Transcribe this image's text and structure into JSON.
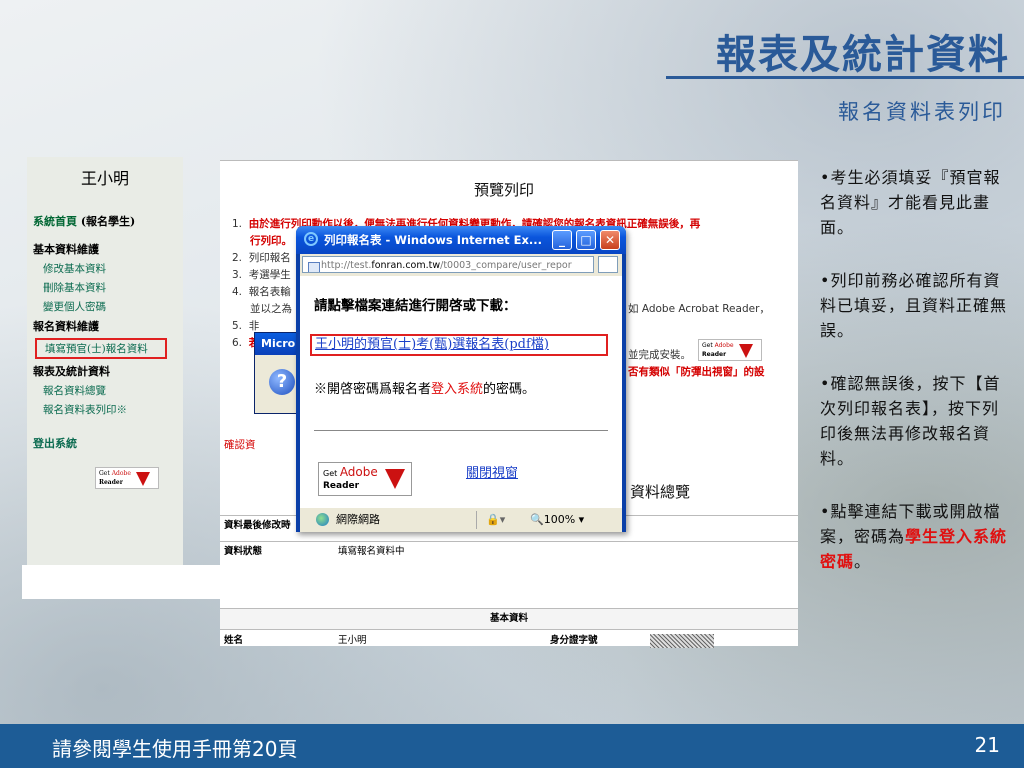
{
  "slide": {
    "title": "報表及統計資料",
    "subtitle": "報名資料表列印",
    "footer_text": "請參閱學生使用手冊第20頁",
    "page_number": "21"
  },
  "nav": {
    "user_name": "王小明",
    "home_label": "系統首頁",
    "home_role": "(報名學生)",
    "sections": [
      {
        "title": "基本資料維護",
        "items": [
          "修改基本資料",
          "刪除基本資料",
          "變更個人密碼"
        ]
      },
      {
        "title": "報名資料維護",
        "items": [
          "填寫預官(士)報名資料"
        ]
      },
      {
        "title": "報表及統計資料",
        "items": [
          "報名資料總覽",
          "報名資料表列印※"
        ]
      }
    ],
    "logout_label": "登出系統",
    "adobe_get": "Get",
    "adobe_brand": "Adobe",
    "adobe_reader": "Reader"
  },
  "web": {
    "title": "預覽列印",
    "items": [
      {
        "num": "1.",
        "text": "由於進行列印動作以後，便無法再進行任何資料變更動作，請確認您的報名表資訊正確無誤後，再",
        "cont": "行列印。"
      },
      {
        "num": "2.",
        "text": "列印報名"
      },
      {
        "num": "3.",
        "text": "考選學生"
      },
      {
        "num": "4.",
        "text": "報名表輸",
        "cont": "並以之為"
      },
      {
        "num": "5.",
        "text": "非"
      },
      {
        "num": "6.",
        "text": "若"
      }
    ],
    "frag_acrobat": "如 Adobe Acrobat Reader，",
    "frag_install": "並完成安裝。",
    "frag_popup": "否有類似「防彈出視窗」的設",
    "confirm_text": "確認資",
    "overview_title": "資料總覽",
    "rows": [
      {
        "key": "資料最後修改時",
        "value": ""
      },
      {
        "key": "資料狀態",
        "value": "填寫報名資料中"
      }
    ],
    "section_header": "基本資料",
    "basic_row": {
      "key1": "姓名",
      "value1": "王小明",
      "key2": "身分證字號"
    }
  },
  "bg_dialog": {
    "title": "Micro"
  },
  "popup": {
    "title": "列印報名表 - Windows Internet Ex...",
    "address_prefix": "http://test.",
    "address_host": "fonran.com.tw",
    "address_path": "/t0003_compare/user_repor",
    "heading": "請點擊檔案連結進行開啓或下載：",
    "file_link": "王小明的預官(士)考(甄)選報名表(pdf檔)",
    "note_prefix": "※開啓密碼爲報名者",
    "note_highlight": "登入系統",
    "note_suffix": "的密碼。",
    "adobe_get": "Get",
    "adobe_brand": "Adobe",
    "adobe_reader": "Reader",
    "close_link": "關閉視窗",
    "status_zone": "網際網路",
    "status_zoom": "100%"
  },
  "notes": {
    "n1": "•考生必須填妥『預官報名資料』才能看見此畫面。",
    "n2": "•列印前務必確認所有資料已填妥，且資料正確無誤。",
    "n3": "•確認無誤後，按下【首次列印報名表】，按下列印後無法再修改報名資料。",
    "n4_prefix": "•點擊連結下載或開啟檔案，密碼為",
    "n4_highlight": "學生登入系統密碼",
    "n4_suffix": "。"
  },
  "colors": {
    "accent_blue": "#2a5a98",
    "footer_blue": "#1d5c96",
    "warning_red": "#e01010",
    "link_blue": "#1a3fc8",
    "nav_green": "#0b6b50"
  }
}
